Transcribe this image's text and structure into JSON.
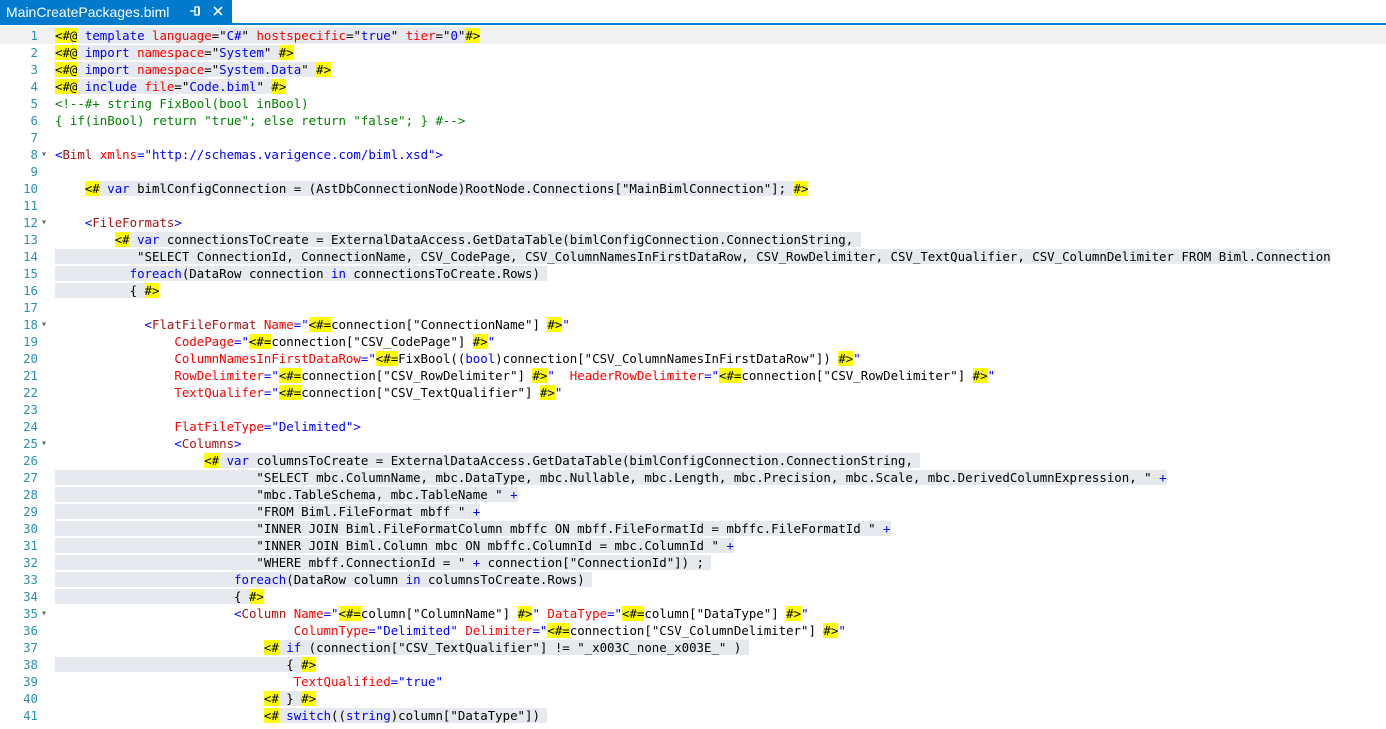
{
  "tab": {
    "title": "MainCreatePackages.biml",
    "pin_icon": "pin-icon",
    "close_icon": "close-icon"
  },
  "editor": {
    "current_line": 1,
    "lines": [
      {
        "n": "1",
        "ind": 0,
        "segs": [
          [
            "d",
            "<#@"
          ],
          [
            "bg",
            " "
          ],
          [
            "bgkw",
            "template"
          ],
          [
            "bg",
            " "
          ],
          [
            "bgan",
            "language"
          ],
          [
            "bg",
            "=\""
          ],
          [
            "bgav",
            "C#"
          ],
          [
            "bg",
            "\" "
          ],
          [
            "bgan",
            "hostspecific"
          ],
          [
            "bg",
            "=\""
          ],
          [
            "bgav",
            "true"
          ],
          [
            "bg",
            "\" "
          ],
          [
            "bgan",
            "tier"
          ],
          [
            "bg",
            "=\""
          ],
          [
            "bgav",
            "0"
          ],
          [
            "bg",
            "\""
          ],
          [
            "d",
            "#>"
          ]
        ]
      },
      {
        "n": "2",
        "ind": 0,
        "segs": [
          [
            "d",
            "<#@"
          ],
          [
            "bg",
            " "
          ],
          [
            "bgkw",
            "import"
          ],
          [
            "bg",
            " "
          ],
          [
            "bgan",
            "namespace"
          ],
          [
            "bg",
            "=\""
          ],
          [
            "bgav",
            "System"
          ],
          [
            "bg",
            "\" "
          ],
          [
            "d",
            "#>"
          ]
        ]
      },
      {
        "n": "3",
        "ind": 0,
        "segs": [
          [
            "d",
            "<#@"
          ],
          [
            "bg",
            " "
          ],
          [
            "bgkw",
            "import"
          ],
          [
            "bg",
            " "
          ],
          [
            "bgan",
            "namespace"
          ],
          [
            "bg",
            "=\""
          ],
          [
            "bgav",
            "System.Data"
          ],
          [
            "bg",
            "\" "
          ],
          [
            "d",
            "#>"
          ]
        ]
      },
      {
        "n": "4",
        "ind": 0,
        "segs": [
          [
            "d",
            "<#@"
          ],
          [
            "bg",
            " "
          ],
          [
            "bgkw",
            "include"
          ],
          [
            "bg",
            " "
          ],
          [
            "bgan",
            "file"
          ],
          [
            "bg",
            "=\""
          ],
          [
            "bgav",
            "Code.biml"
          ],
          [
            "bg",
            "\" "
          ],
          [
            "d",
            "#>"
          ]
        ]
      },
      {
        "n": "5",
        "ind": 0,
        "segs": [
          [
            "cm",
            "<!--#+ string FixBool(bool inBool)"
          ]
        ]
      },
      {
        "n": "6",
        "ind": 0,
        "segs": [
          [
            "cm",
            "{ if(inBool) return \"true\"; else return \"false\"; } #-->"
          ]
        ]
      },
      {
        "n": "7",
        "ind": 0,
        "segs": []
      },
      {
        "n": "8",
        "ind": 0,
        "fold": true,
        "segs": [
          [
            "br",
            "<"
          ],
          [
            "tg",
            "Biml"
          ],
          [
            "t",
            " "
          ],
          [
            "an",
            "xmlns"
          ],
          [
            "br",
            "=\""
          ],
          [
            "av",
            "http://schemas.varigence.com/biml.xsd"
          ],
          [
            "br",
            "\">"
          ]
        ]
      },
      {
        "n": "9",
        "ind": 0,
        "segs": []
      },
      {
        "n": "10",
        "ind": 4,
        "segs": [
          [
            "d",
            "<#"
          ],
          [
            "bg",
            " "
          ],
          [
            "bgkw",
            "var"
          ],
          [
            "bg",
            " bimlConfigConnection = (AstDbConnectionNode)RootNode.Connections[\"MainBimlConnection\"]; "
          ],
          [
            "d",
            "#>"
          ]
        ]
      },
      {
        "n": "11",
        "ind": 0,
        "segs": []
      },
      {
        "n": "12",
        "ind": 4,
        "fold": true,
        "segs": [
          [
            "br",
            "<"
          ],
          [
            "tg",
            "FileFormats"
          ],
          [
            "br",
            ">"
          ]
        ]
      },
      {
        "n": "13",
        "ind": 8,
        "segs": [
          [
            "d",
            "<#"
          ],
          [
            "bg",
            " "
          ],
          [
            "bgkw",
            "var"
          ],
          [
            "bg",
            " connectionsToCreate = ExternalDataAccess.GetDataTable(bimlConfigConnection.ConnectionString, "
          ]
        ]
      },
      {
        "n": "14",
        "ind": 0,
        "segs": [
          [
            "bg",
            "           \"SELECT ConnectionId, ConnectionName, CSV_CodePage, CSV_ColumnNamesInFirstDataRow, CSV_RowDelimiter, CSV_TextQualifier, CSV_ColumnDelimiter FROM Biml.Connection"
          ]
        ]
      },
      {
        "n": "15",
        "ind": 0,
        "segs": [
          [
            "bg",
            "          "
          ],
          [
            "bgkw",
            "foreach"
          ],
          [
            "bg",
            "(DataRow connection "
          ],
          [
            "bgkw",
            "in"
          ],
          [
            "bg",
            " connectionsToCreate.Rows) "
          ]
        ]
      },
      {
        "n": "16",
        "ind": 0,
        "segs": [
          [
            "bg",
            "          { "
          ],
          [
            "d",
            "#>"
          ]
        ]
      },
      {
        "n": "17",
        "ind": 0,
        "segs": []
      },
      {
        "n": "18",
        "ind": 12,
        "fold": true,
        "segs": [
          [
            "br",
            "<"
          ],
          [
            "tg",
            "FlatFileFormat"
          ],
          [
            "t",
            " "
          ],
          [
            "an",
            "Name"
          ],
          [
            "br",
            "=\""
          ],
          [
            "d",
            "<#="
          ],
          [
            "t",
            "connection[\"ConnectionName\"] "
          ],
          [
            "d",
            "#>"
          ],
          [
            "br",
            "\""
          ]
        ]
      },
      {
        "n": "19",
        "ind": 16,
        "segs": [
          [
            "an",
            "CodePage"
          ],
          [
            "br",
            "=\""
          ],
          [
            "d",
            "<#="
          ],
          [
            "t",
            "connection[\"CSV_CodePage\"] "
          ],
          [
            "d",
            "#>"
          ],
          [
            "br",
            "\""
          ]
        ]
      },
      {
        "n": "20",
        "ind": 16,
        "segs": [
          [
            "an",
            "ColumnNamesInFirstDataRow"
          ],
          [
            "br",
            "=\""
          ],
          [
            "d",
            "<#="
          ],
          [
            "t",
            "FixBool(("
          ],
          [
            "kw",
            "bool"
          ],
          [
            "t",
            ")connection[\"CSV_ColumnNamesInFirstDataRow\"]) "
          ],
          [
            "d",
            "#>"
          ],
          [
            "br",
            "\""
          ]
        ]
      },
      {
        "n": "21",
        "ind": 16,
        "segs": [
          [
            "an",
            "RowDelimiter"
          ],
          [
            "br",
            "=\""
          ],
          [
            "d",
            "<#="
          ],
          [
            "t",
            "connection[\"CSV_RowDelimiter\"] "
          ],
          [
            "d",
            "#>"
          ],
          [
            "br",
            "\"  "
          ],
          [
            "an",
            "HeaderRowDelimiter"
          ],
          [
            "br",
            "=\""
          ],
          [
            "d",
            "<#="
          ],
          [
            "t",
            "connection[\"CSV_RowDelimiter\"] "
          ],
          [
            "d",
            "#>"
          ],
          [
            "br",
            "\""
          ]
        ]
      },
      {
        "n": "22",
        "ind": 16,
        "segs": [
          [
            "an",
            "TextQualifer"
          ],
          [
            "br",
            "=\""
          ],
          [
            "d",
            "<#="
          ],
          [
            "t",
            "connection[\"CSV_TextQualifier\"] "
          ],
          [
            "d",
            "#>"
          ],
          [
            "br",
            "\""
          ]
        ]
      },
      {
        "n": "23",
        "ind": 0,
        "segs": []
      },
      {
        "n": "24",
        "ind": 16,
        "segs": [
          [
            "an",
            "FlatFileType"
          ],
          [
            "br",
            "=\""
          ],
          [
            "av",
            "Delimited"
          ],
          [
            "br",
            "\">"
          ]
        ]
      },
      {
        "n": "25",
        "ind": 16,
        "fold": true,
        "segs": [
          [
            "br",
            "<"
          ],
          [
            "tg",
            "Columns"
          ],
          [
            "br",
            ">"
          ]
        ]
      },
      {
        "n": "26",
        "ind": 20,
        "segs": [
          [
            "d",
            "<#"
          ],
          [
            "bg",
            " "
          ],
          [
            "bgkw",
            "var"
          ],
          [
            "bg",
            " columnsToCreate = ExternalDataAccess.GetDataTable(bimlConfigConnection.ConnectionString, "
          ]
        ]
      },
      {
        "n": "27",
        "ind": 0,
        "segs": [
          [
            "bg",
            "                           \"SELECT mbc.ColumnName, mbc.DataType, mbc.Nullable, mbc.Length, mbc.Precision, mbc.Scale, mbc.DerivedColumnExpression, \" "
          ],
          [
            "bgkw",
            "+"
          ]
        ]
      },
      {
        "n": "28",
        "ind": 0,
        "segs": [
          [
            "bg",
            "                           \"mbc.TableSchema, mbc.TableName \" "
          ],
          [
            "bgkw",
            "+"
          ]
        ]
      },
      {
        "n": "29",
        "ind": 0,
        "segs": [
          [
            "bg",
            "                           \"FROM Biml.FileFormat mbff \" "
          ],
          [
            "bgkw",
            "+"
          ]
        ]
      },
      {
        "n": "30",
        "ind": 0,
        "segs": [
          [
            "bg",
            "                           \"INNER JOIN Biml.FileFormatColumn mbffc ON mbff.FileFormatId = mbffc.FileFormatId \" "
          ],
          [
            "bgkw",
            "+"
          ]
        ]
      },
      {
        "n": "31",
        "ind": 0,
        "segs": [
          [
            "bg",
            "                           \"INNER JOIN Biml.Column mbc ON mbffc.ColumnId = mbc.ColumnId \" "
          ],
          [
            "bgkw",
            "+"
          ]
        ]
      },
      {
        "n": "32",
        "ind": 0,
        "segs": [
          [
            "bg",
            "                           \"WHERE mbff.ConnectionId = \" "
          ],
          [
            "bgkw",
            "+"
          ],
          [
            "bg",
            " connection[\"ConnectionId\"]) ; "
          ]
        ]
      },
      {
        "n": "33",
        "ind": 0,
        "segs": [
          [
            "bg",
            "                        "
          ],
          [
            "bgkw",
            "foreach"
          ],
          [
            "bg",
            "(DataRow column "
          ],
          [
            "bgkw",
            "in"
          ],
          [
            "bg",
            " columnsToCreate.Rows) "
          ]
        ]
      },
      {
        "n": "34",
        "ind": 0,
        "segs": [
          [
            "bg",
            "                        { "
          ],
          [
            "d",
            "#>"
          ]
        ]
      },
      {
        "n": "35",
        "ind": 24,
        "fold": true,
        "segs": [
          [
            "br",
            "<"
          ],
          [
            "tg",
            "Column"
          ],
          [
            "t",
            " "
          ],
          [
            "an",
            "Name"
          ],
          [
            "br",
            "=\""
          ],
          [
            "d",
            "<#="
          ],
          [
            "t",
            "column[\"ColumnName\"] "
          ],
          [
            "d",
            "#>"
          ],
          [
            "br",
            "\" "
          ],
          [
            "an",
            "DataType"
          ],
          [
            "br",
            "=\""
          ],
          [
            "d",
            "<#="
          ],
          [
            "t",
            "column[\"DataType\"] "
          ],
          [
            "d",
            "#>"
          ],
          [
            "br",
            "\""
          ]
        ]
      },
      {
        "n": "36",
        "ind": 32,
        "segs": [
          [
            "an",
            "ColumnType"
          ],
          [
            "br",
            "=\""
          ],
          [
            "av",
            "Delimited"
          ],
          [
            "br",
            "\" "
          ],
          [
            "an",
            "Delimiter"
          ],
          [
            "br",
            "=\""
          ],
          [
            "d",
            "<#="
          ],
          [
            "t",
            "connection[\"CSV_ColumnDelimiter\"] "
          ],
          [
            "d",
            "#>"
          ],
          [
            "br",
            "\""
          ]
        ]
      },
      {
        "n": "37",
        "ind": 28,
        "segs": [
          [
            "d",
            "<#"
          ],
          [
            "bg",
            " "
          ],
          [
            "bgkw",
            "if"
          ],
          [
            "bg",
            " (connection[\"CSV_TextQualifier\"] != \"_x003C_none_x003E_\" ) "
          ]
        ]
      },
      {
        "n": "38",
        "ind": 0,
        "segs": [
          [
            "bg",
            "                               { "
          ],
          [
            "d",
            "#>"
          ]
        ]
      },
      {
        "n": "39",
        "ind": 32,
        "segs": [
          [
            "an",
            "TextQualified"
          ],
          [
            "br",
            "=\""
          ],
          [
            "av",
            "true"
          ],
          [
            "br",
            "\""
          ]
        ]
      },
      {
        "n": "40",
        "ind": 28,
        "segs": [
          [
            "d",
            "<#"
          ],
          [
            "bg",
            " } "
          ],
          [
            "d",
            "#>"
          ]
        ]
      },
      {
        "n": "41",
        "ind": 28,
        "segs": [
          [
            "d",
            "<#"
          ],
          [
            "bg",
            " "
          ],
          [
            "bgkw",
            "switch"
          ],
          [
            "bg",
            "(("
          ],
          [
            "bgkw",
            "string"
          ],
          [
            "bg",
            ")column[\"DataType\"]) "
          ]
        ]
      }
    ]
  }
}
